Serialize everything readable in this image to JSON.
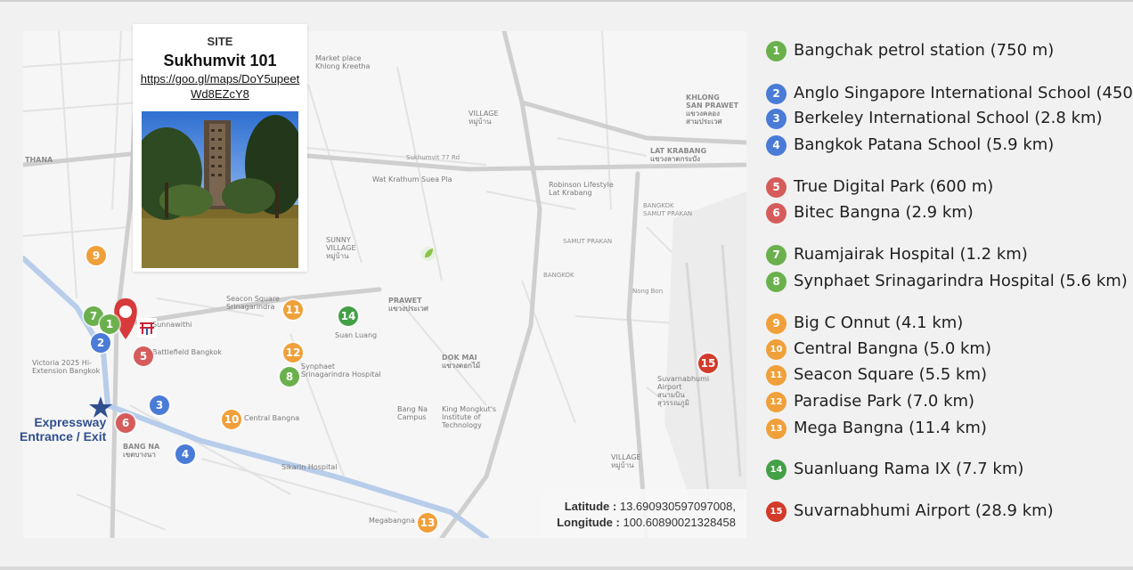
{
  "site": {
    "label": "SITE",
    "name": "Sukhumvit 101",
    "url": "https://goo.gl/maps/DoY5upeetWd8EZcY8"
  },
  "coordinates": {
    "latitude_label": "Latitude :",
    "latitude_value": "13.690930597097008,",
    "longitude_label": "Longitude :",
    "longitude_value": "100.60890021328458"
  },
  "expressway_label": {
    "line1": "Expressway",
    "line2": "Entrance / Exit"
  },
  "map_labels": {
    "khlong_san_prawet": "KHLONG\nSAN PRAWET\nแขวงคลอง\nสามประเวศ",
    "lat_krabang": "LAT KRABANG\nแขวงลาดกระบัง",
    "prawet": "PRAWET\nแขวงประเวศ",
    "dok_mai": "DOK MAI\nแขวงดอกไม้",
    "bang_na": "BANG NA\nเขตบางนา",
    "thana": "THANA",
    "market_place": "Market place\nKhlong Kreetha",
    "sukhumvit77": "Sukhumvit 77 Rd",
    "wat_krathum": "Wat Krathum Suea Pla",
    "robinson": "Robinson Lifestyle\nLat Krabang",
    "true_digital": "True Digital Park",
    "battlefield": "Battlefield Bangkok",
    "victoria": "Victoria 2025 Hi-\nExtension Bangkok",
    "seacon": "Seacon Square\nSrinagarindra",
    "synphaet": "Synphaet\nSrinagarindra Hospital",
    "suan_luang": "Suan Luang",
    "central_bangna": "Central Bangna",
    "sikarin": "Sikarin Hospital",
    "megabangna": "Megabangna",
    "suvarnabhumi_airport": "Suvarnabhumi\nAirport\nสนามบิน\nสุวรรณภูมิ",
    "bangna_campus": "Bang Na\nCampus",
    "king_mongkut": "King Mongkut's\nInstitute of\nTechnology",
    "sunnawithi": "Sunnawithi",
    "samut_prakan": "SAMUT PRAKAN",
    "bangkok_road": "BANGKOK",
    "nong_bon": "Nong Bon",
    "bangkok_east": "BANGKOK\nSAMUT PRAKAN",
    "village_1": "VILLAGE\nหมู่บ้าน",
    "sunnay_village": "SUNNY\nVILLAGE\nหมู่บ้าน",
    "tint_village": "VILLAGE\nหมู่บ้าน"
  },
  "markers": [
    {
      "num": "1",
      "color": "#6ab04c"
    },
    {
      "num": "2",
      "color": "#4a7bd6"
    },
    {
      "num": "3",
      "color": "#4a7bd6"
    },
    {
      "num": "4",
      "color": "#4a7bd6"
    },
    {
      "num": "5",
      "color": "#d65c5c"
    },
    {
      "num": "6",
      "color": "#d65c5c"
    },
    {
      "num": "7",
      "color": "#6ab04c"
    },
    {
      "num": "8",
      "color": "#6ab04c"
    },
    {
      "num": "9",
      "color": "#f0a03a"
    },
    {
      "num": "10",
      "color": "#f0a03a"
    },
    {
      "num": "11",
      "color": "#f0a03a"
    },
    {
      "num": "12",
      "color": "#f0a03a"
    },
    {
      "num": "13",
      "color": "#f0a03a"
    },
    {
      "num": "14",
      "color": "#43a047"
    },
    {
      "num": "15",
      "color": "#d23a2a"
    }
  ],
  "legend": [
    {
      "num": "1",
      "text": "Bangchak petrol station (750 m)",
      "color": "#6ab04c"
    },
    {
      "num": "2",
      "text": "Anglo Singapore International School (450 m)",
      "color": "#4a7bd6"
    },
    {
      "num": "3",
      "text": "Berkeley International School (2.8 km)",
      "color": "#4a7bd6"
    },
    {
      "num": "4",
      "text": "Bangkok Patana School (5.9 km)",
      "color": "#4a7bd6"
    },
    {
      "num": "5",
      "text": "True Digital Park (600 m)",
      "color": "#d65c5c"
    },
    {
      "num": "6",
      "text": "Bitec Bangna (2.9 km)",
      "color": "#d65c5c"
    },
    {
      "num": "7",
      "text": "Ruamjairak Hospital (1.2 km)",
      "color": "#6ab04c"
    },
    {
      "num": "8",
      "text": "Synphaet Srinagarindra Hospital (5.6 km)",
      "color": "#6ab04c"
    },
    {
      "num": "9",
      "text": "Big C Onnut (4.1 km)",
      "color": "#f0a03a"
    },
    {
      "num": "10",
      "text": "Central Bangna (5.0 km)",
      "color": "#f0a03a"
    },
    {
      "num": "11",
      "text": "Seacon Square (5.5 km)",
      "color": "#f0a03a"
    },
    {
      "num": "12",
      "text": "Paradise Park (7.0 km)",
      "color": "#f0a03a"
    },
    {
      "num": "13",
      "text": "Mega Bangna (11.4 km)",
      "color": "#f0a03a"
    },
    {
      "num": "14",
      "text": "Suanluang Rama IX (7.7 km)",
      "color": "#43a047"
    },
    {
      "num": "15",
      "text": "Suvarnabhumi Airport (28.9 km)",
      "color": "#d23a2a"
    }
  ]
}
